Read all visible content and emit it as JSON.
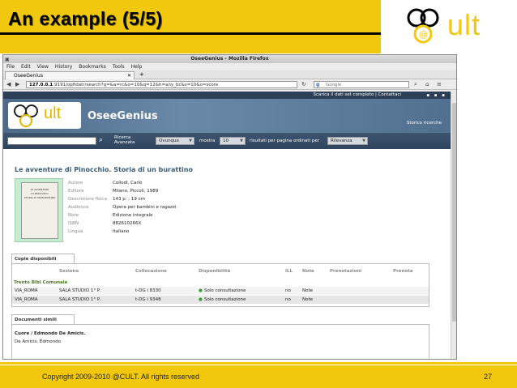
{
  "slide": {
    "title": "An example (5/5)",
    "logo_text": "ult",
    "footer": {
      "copyright": "Copyright 2009-2010 @CULT. All rights reserved",
      "page": "27"
    }
  },
  "browser": {
    "window_title": "OseeGenius - Mozilla Firefox",
    "menu": [
      "File",
      "Edit",
      "View",
      "History",
      "Bookmarks",
      "Tools",
      "Help"
    ],
    "tab_label": "OseeGenius",
    "url_host": "127.0.0.1",
    "url_rest": ":9191/opfidatr/search?q=&a=rc&o=10&q=12&h=any_bc&s=10&o=score",
    "search_engine": "Google"
  },
  "page": {
    "top_links": "Scarica il dati set completo  |  Contattaci",
    "site_name": "OseeGenius",
    "site_logo_text": "ult",
    "storico": "Storico ricerche",
    "ricerca_avanzata": [
      "Ricerca",
      "Avanzata"
    ],
    "scope_value": "Ovunque",
    "mostra_label": "mostra",
    "per_page_value": "10",
    "results_label": "risultati per pagina ordinati per",
    "order_value": "Rilevanza",
    "book_title": "Le avventure di Pinocchio. Storia di un burattino",
    "cover_text": [
      "LE AVVENTURE",
      "DI PINOCCHIO",
      "STORIA DI UN BURATTINO"
    ],
    "details": [
      {
        "key": "Autore",
        "value": "Collodi, Carlo"
      },
      {
        "key": "Editore",
        "value": "Milano, Piccoli, 1989"
      },
      {
        "key": "Descrizione fisica",
        "value": "143 p. ; 19 cm"
      },
      {
        "key": "Audience",
        "value": "Opera per bambini e ragazzi"
      },
      {
        "key": "Note",
        "value": "Edizione integrale"
      },
      {
        "key": "ISBN",
        "value": "882610266X"
      },
      {
        "key": "Lingua",
        "value": "Italiano"
      }
    ],
    "copies_tab": "Copie disponibili",
    "copies_headers": [
      "Sezione",
      "Collocazione",
      "Disponibilità",
      "ILL",
      "Note",
      "Prenotazioni",
      "Prenota"
    ],
    "library": "Trento Bibl Comunale",
    "copies": [
      {
        "loc": "VIA_ROMA",
        "section": "SALA STUDIO 1° P.",
        "shelf": "t-DG i 8330",
        "avail": "Solo consultazione",
        "ill": "no",
        "note": "Note"
      },
      {
        "loc": "VIA_ROMA",
        "section": "SALA STUDIO 1° P.",
        "shelf": "t-DG i 9348",
        "avail": "Solo consultazione",
        "ill": "no",
        "note": "Note"
      }
    ],
    "similar_tab": "Documenti simili",
    "similar_title": "Cuore / Edmondo De Amicis.",
    "similar_author": "De Amicis, Edmondo"
  }
}
